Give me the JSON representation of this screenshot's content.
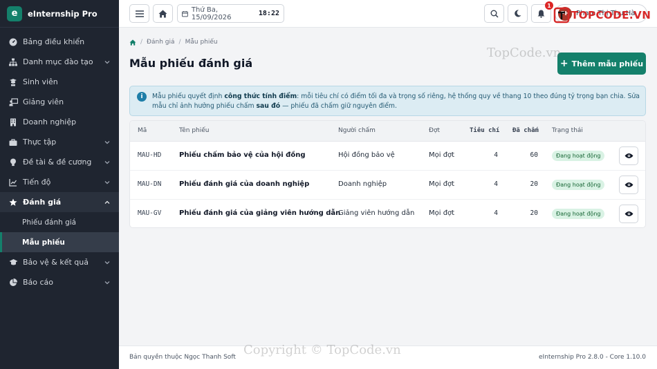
{
  "brand": {
    "logo_letter": "e",
    "name": "eInternship Pro"
  },
  "sidebar": {
    "items": [
      {
        "label": "Bảng điều khiển",
        "icon": "gauge-icon",
        "has_children": false
      },
      {
        "label": "Danh mục đào tạo",
        "icon": "sitemap-icon",
        "has_children": true
      },
      {
        "label": "Sinh viên",
        "icon": "graduate-icon",
        "has_children": false
      },
      {
        "label": "Giảng viên",
        "icon": "teacher-icon",
        "has_children": false
      },
      {
        "label": "Doanh nghiệp",
        "icon": "building-icon",
        "has_children": false
      },
      {
        "label": "Thực tập",
        "icon": "briefcase-icon",
        "has_children": true
      },
      {
        "label": "Đề tài & đề cương",
        "icon": "lightbulb-icon",
        "has_children": true
      },
      {
        "label": "Tiến độ",
        "icon": "chart-line-icon",
        "has_children": true
      },
      {
        "label": "Đánh giá",
        "icon": "star-icon",
        "has_children": true,
        "active": true
      },
      {
        "label": "Bảo vệ & kết quả",
        "icon": "graduation-cap-icon",
        "has_children": true
      },
      {
        "label": "Báo cáo",
        "icon": "pie-chart-icon",
        "has_children": true
      }
    ],
    "sub_items": [
      {
        "label": "Phiếu đánh giá",
        "current": false
      },
      {
        "label": "Mẫu phiếu",
        "current": true
      }
    ]
  },
  "topbar": {
    "date": "Thứ Ba, 15/09/2026",
    "time": "18:22",
    "notification_count": "1",
    "user_name": "Phạm Thị Thu Hà",
    "user_initials": "PH"
  },
  "breadcrumb": {
    "level1": "Đánh giá",
    "level2": "Mẫu phiếu"
  },
  "page": {
    "title": "Mẫu phiếu đánh giá",
    "add_button": "Thêm mẫu phiếu"
  },
  "info": {
    "p1": "Mẫu phiếu quyết định ",
    "b1": "công thức tính điểm",
    "p2": ": mỗi tiêu chí có điểm tối đa và trọng số riêng, hệ thống quy về thang 10 theo đúng tỷ trọng bạn chia. Sửa mẫu chỉ ảnh hưởng phiếu chấm ",
    "b2": "sau đó",
    "p3": " — phiếu đã chấm giữ nguyên điểm."
  },
  "table": {
    "headers": {
      "code": "Mã",
      "name": "Tên phiếu",
      "grader": "Người chấm",
      "round": "Đợt",
      "criteria": "Tiêu chí",
      "graded": "Đã chấm",
      "status": "Trạng thái"
    },
    "rows": [
      {
        "code": "MAU-HD",
        "name": "Phiếu chấm bảo vệ của hội đồng",
        "grader": "Hội đồng bảo vệ",
        "round": "Mọi đợt",
        "criteria": "4",
        "graded": "60",
        "status": "Đang hoạt động"
      },
      {
        "code": "MAU-DN",
        "name": "Phiếu đánh giá của doanh nghiệp",
        "grader": "Doanh nghiệp",
        "round": "Mọi đợt",
        "criteria": "4",
        "graded": "20",
        "status": "Đang hoạt động"
      },
      {
        "code": "MAU-GV",
        "name": "Phiếu đánh giá của giảng viên hướng dẫn",
        "grader": "Giảng viên hướng dẫn",
        "round": "Mọi đợt",
        "criteria": "4",
        "graded": "20",
        "status": "Đang hoạt động"
      }
    ]
  },
  "footer": {
    "left": "Bản quyền thuộc Ngọc Thanh Soft",
    "right": "eInternship Pro 2.8.0 - Core 1.10.0"
  },
  "watermarks": {
    "top": "TopCode.vn",
    "bottom": "Copyright © TopCode.vn",
    "logo": "TOPCODE.VN"
  },
  "colors": {
    "accent": "#14806b",
    "sidebar_bg": "#1f2530",
    "info_bg": "#dcecf3",
    "status_bg": "#d9f2e4"
  }
}
